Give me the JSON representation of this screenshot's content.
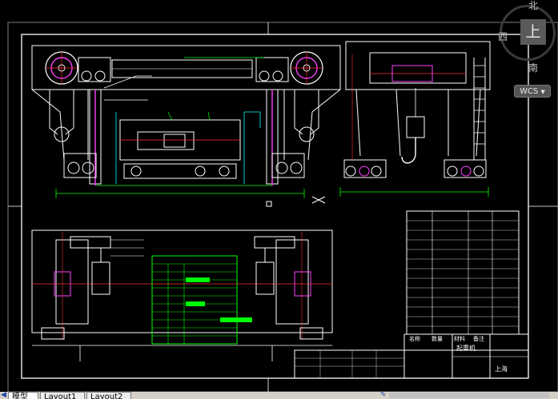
{
  "viewcube": {
    "north": "北",
    "south": "南",
    "west": "西",
    "top_face": "上",
    "coordinate_system": "WCS"
  },
  "layout_tabs": [
    {
      "label": "模型",
      "active": true
    },
    {
      "label": "Layout1",
      "active": false
    },
    {
      "label": "Layout2",
      "active": false
    }
  ],
  "drawing": {
    "title_block_name": "起重机",
    "title_block_mark": "上海",
    "table_header": [
      "名称",
      "数量",
      "材料",
      "备注"
    ],
    "colors": {
      "background": "#000000",
      "lines": "#ffffff",
      "centerlines": "#ff3030",
      "dimensions": "#00ff00",
      "highlights": "#ff00ff",
      "hidden": "#00ffff",
      "table": "#00ff00"
    }
  }
}
